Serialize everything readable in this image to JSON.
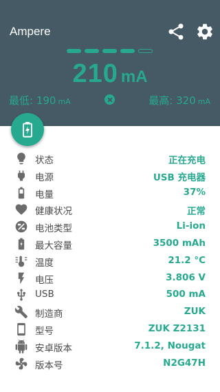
{
  "app": {
    "title": "Ampere"
  },
  "colors": {
    "header": "#455a64",
    "accent": "#27a990",
    "label": "#4a4a4a"
  },
  "toolbar": {
    "share_icon": "share-icon",
    "settings_icon": "settings-icon"
  },
  "level": {
    "filled": 4,
    "total": 5
  },
  "current": {
    "value": "210",
    "unit": "mA"
  },
  "min": {
    "label": "最低: 190",
    "unit": "mA"
  },
  "max": {
    "label": "最高: 320",
    "unit": "mA"
  },
  "fab": {
    "icon": "battery-charging-icon"
  },
  "rows": [
    {
      "icon": "bulb-icon",
      "label": "状态",
      "value": "正在充电"
    },
    {
      "icon": "power-plug-icon",
      "label": "电源",
      "value": "USB 充电器"
    },
    {
      "icon": "battery-icon",
      "label": "电量",
      "value": "37%"
    },
    {
      "icon": "heart-icon",
      "label": "健康状况",
      "value": "正常"
    },
    {
      "icon": "battery-type-icon",
      "label": "电池类型",
      "value": "Li-ion"
    },
    {
      "icon": "battery-capacity-icon",
      "label": "最大容量",
      "value": "3500 mAh"
    },
    {
      "icon": "thermometer-icon",
      "label": "温度",
      "value": "21.2 °C"
    },
    {
      "icon": "flash-icon",
      "label": "电压",
      "value": "3.806 V"
    },
    {
      "icon": "usb-icon",
      "label": "USB",
      "value": "500 mA"
    },
    {
      "icon": "wrench-icon",
      "label": "制造商",
      "value": "ZUK"
    },
    {
      "icon": "phone-icon",
      "label": "型号",
      "value": "ZUK Z2131"
    },
    {
      "icon": "android-icon",
      "label": "安卓版本",
      "value": "7.1.2, Nougat"
    },
    {
      "icon": "fan-icon",
      "label": "版本号",
      "value": "N2G47H"
    }
  ]
}
